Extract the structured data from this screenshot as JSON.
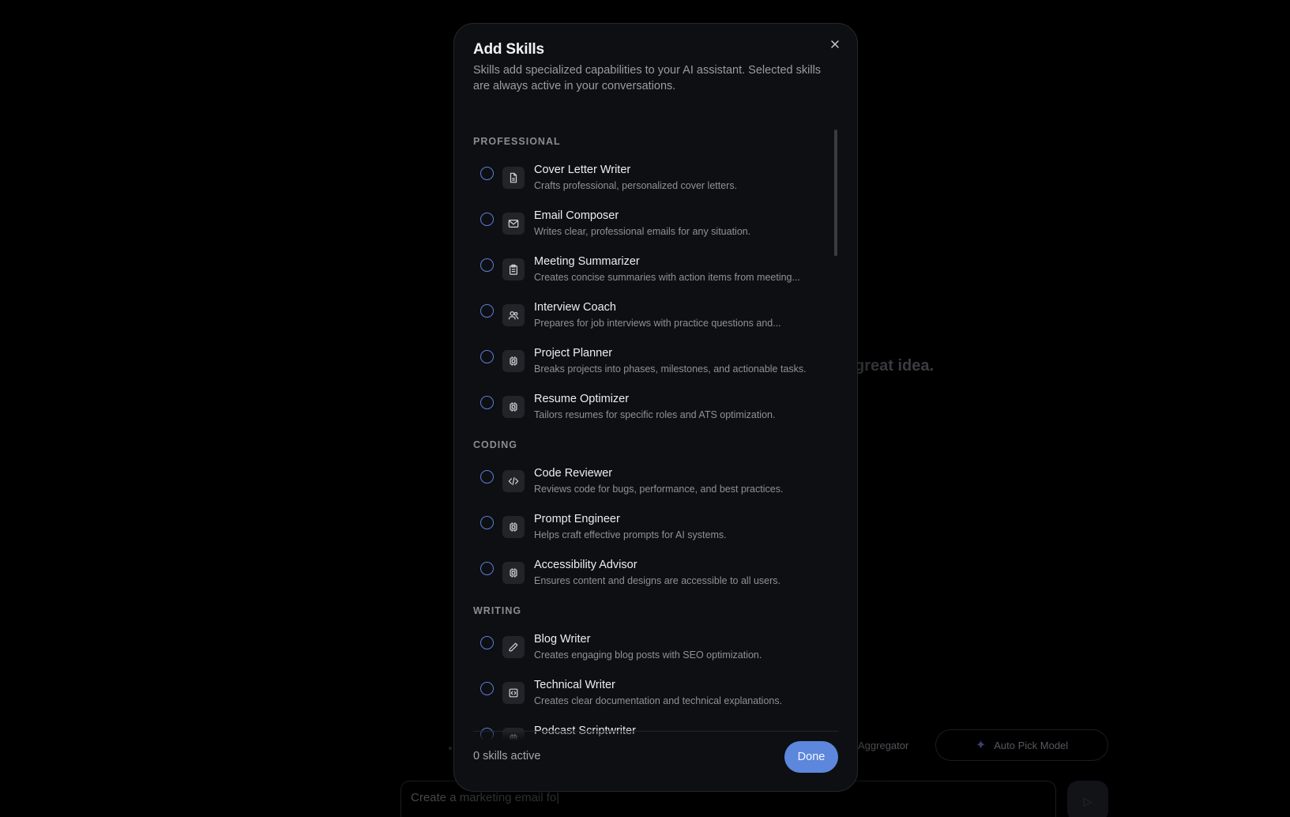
{
  "background": {
    "hero_text": "great idea.",
    "chip_aggregator": "Aggregator",
    "chip_auto_pick": "Auto Pick Model",
    "input_value": "Create a marketing email fo|"
  },
  "modal": {
    "title": "Add Skills",
    "description": "Skills add specialized capabilities to your AI assistant. Selected skills are always active in your conversations.",
    "sections": [
      {
        "title": "PROFESSIONAL",
        "skills": [
          {
            "name": "Cover Letter Writer",
            "desc": "Crafts professional, personalized cover letters.",
            "icon": "document-icon",
            "selected": false
          },
          {
            "name": "Email Composer",
            "desc": "Writes clear, professional emails for any situation.",
            "icon": "mail-icon",
            "selected": false
          },
          {
            "name": "Meeting Summarizer",
            "desc": "Creates concise summaries with action items from meeting...",
            "icon": "clipboard-icon",
            "selected": false
          },
          {
            "name": "Interview Coach",
            "desc": "Prepares for job interviews with practice questions and...",
            "icon": "users-icon",
            "selected": false
          },
          {
            "name": "Project Planner",
            "desc": "Breaks projects into phases, milestones, and actionable tasks.",
            "icon": "chip-icon",
            "selected": false
          },
          {
            "name": "Resume Optimizer",
            "desc": "Tailors resumes for specific roles and ATS optimization.",
            "icon": "chip-icon",
            "selected": false
          }
        ]
      },
      {
        "title": "CODING",
        "skills": [
          {
            "name": "Code Reviewer",
            "desc": "Reviews code for bugs, performance, and best practices.",
            "icon": "code-icon",
            "selected": false
          },
          {
            "name": "Prompt Engineer",
            "desc": "Helps craft effective prompts for AI systems.",
            "icon": "chip-icon",
            "selected": false
          },
          {
            "name": "Accessibility Advisor",
            "desc": "Ensures content and designs are accessible to all users.",
            "icon": "chip-icon",
            "selected": false
          }
        ]
      },
      {
        "title": "WRITING",
        "skills": [
          {
            "name": "Blog Writer",
            "desc": "Creates engaging blog posts with SEO optimization.",
            "icon": "pencil-icon",
            "selected": false
          },
          {
            "name": "Technical Writer",
            "desc": "Creates clear documentation and technical explanations.",
            "icon": "code-file-icon",
            "selected": false
          },
          {
            "name": "Podcast Scriptwriter",
            "desc": "",
            "icon": "chip-icon",
            "selected": false
          }
        ]
      }
    ],
    "footer": {
      "active_count": "0 skills active",
      "done_label": "Done"
    },
    "colors": {
      "accent": "#5c87dd",
      "radio_border": "#5b7fd6",
      "modal_bg": "#0e0f12"
    }
  }
}
